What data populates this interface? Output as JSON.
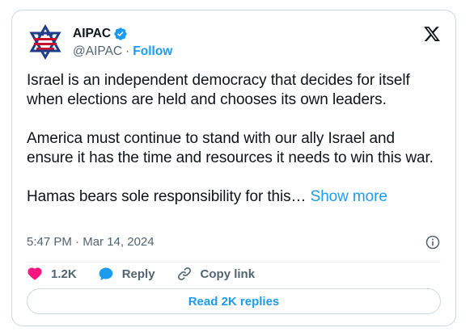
{
  "author": {
    "display_name": "AIPAC",
    "handle": "@AIPAC",
    "separator": "·",
    "follow_label": "Follow",
    "verified": true,
    "avatar_icon": "aipac-star-logo"
  },
  "platform_icon": "x-logo-icon",
  "tweet": {
    "paragraphs": [
      "Israel is an independent democracy that decides for itself when elections are held and chooses its own leaders.",
      "America must continue to stand with our ally Israel and ensure it has the time and resources it needs to win this war.",
      "Hamas bears sole responsibility for this…"
    ],
    "show_more_label": "Show more"
  },
  "meta": {
    "time": "5:47 PM",
    "separator": "·",
    "date": "Mar 14, 2024"
  },
  "actions": {
    "like_count": "1.2K",
    "reply_label": "Reply",
    "copy_link_label": "Copy link"
  },
  "read_replies_label": "Read 2K replies",
  "colors": {
    "accent": "#1d9bf0",
    "like": "#f91880",
    "text": "#0f1419",
    "secondary": "#536471",
    "border": "#cfd9de"
  }
}
